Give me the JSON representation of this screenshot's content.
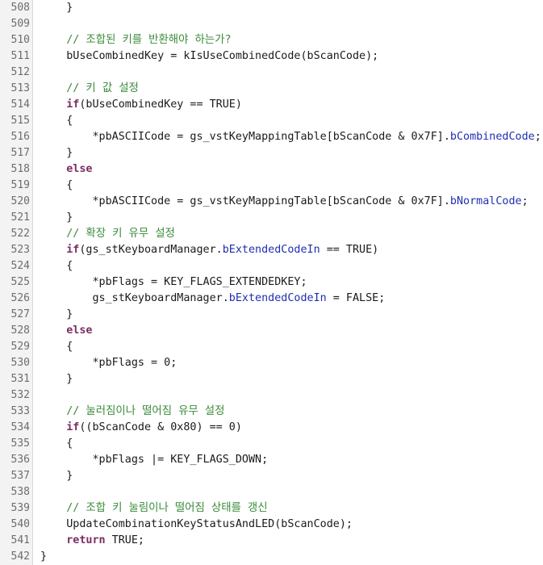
{
  "colors": {
    "gutter_bg": "#f3f3f3",
    "line_number": "#6d6d6d",
    "text": "#1a1a1a",
    "comment": "#3a8a3a",
    "keyword": "#7b2d63",
    "field": "#1f2fb0"
  },
  "lines": [
    {
      "num": "508",
      "tokens": [
        {
          "t": "plain",
          "v": "    }"
        }
      ]
    },
    {
      "num": "509",
      "tokens": []
    },
    {
      "num": "510",
      "tokens": [
        {
          "t": "comment",
          "v": "    // 조합된 키를 반환해야 하는가?"
        }
      ]
    },
    {
      "num": "511",
      "tokens": [
        {
          "t": "plain",
          "v": "    bUseCombinedKey = kIsUseCombinedCode(bScanCode);"
        }
      ]
    },
    {
      "num": "512",
      "tokens": []
    },
    {
      "num": "513",
      "tokens": [
        {
          "t": "comment",
          "v": "    // 키 값 설정"
        }
      ]
    },
    {
      "num": "514",
      "tokens": [
        {
          "t": "plain",
          "v": "    "
        },
        {
          "t": "keyword",
          "v": "if"
        },
        {
          "t": "plain",
          "v": "(bUseCombinedKey == TRUE)"
        }
      ]
    },
    {
      "num": "515",
      "tokens": [
        {
          "t": "plain",
          "v": "    {"
        }
      ]
    },
    {
      "num": "516",
      "tokens": [
        {
          "t": "plain",
          "v": "        *pbASCIICode = gs_vstKeyMappingTable[bScanCode & 0x7F]."
        },
        {
          "t": "field",
          "v": "bCombinedCode"
        },
        {
          "t": "plain",
          "v": ";"
        }
      ]
    },
    {
      "num": "517",
      "tokens": [
        {
          "t": "plain",
          "v": "    }"
        }
      ]
    },
    {
      "num": "518",
      "tokens": [
        {
          "t": "plain",
          "v": "    "
        },
        {
          "t": "keyword",
          "v": "else"
        }
      ]
    },
    {
      "num": "519",
      "tokens": [
        {
          "t": "plain",
          "v": "    {"
        }
      ]
    },
    {
      "num": "520",
      "tokens": [
        {
          "t": "plain",
          "v": "        *pbASCIICode = gs_vstKeyMappingTable[bScanCode & 0x7F]."
        },
        {
          "t": "field",
          "v": "bNormalCode"
        },
        {
          "t": "plain",
          "v": ";"
        }
      ]
    },
    {
      "num": "521",
      "tokens": [
        {
          "t": "plain",
          "v": "    }"
        }
      ]
    },
    {
      "num": "522",
      "tokens": [
        {
          "t": "comment",
          "v": "    // 확장 키 유무 설정"
        }
      ]
    },
    {
      "num": "523",
      "tokens": [
        {
          "t": "plain",
          "v": "    "
        },
        {
          "t": "keyword",
          "v": "if"
        },
        {
          "t": "plain",
          "v": "(gs_stKeyboardManager."
        },
        {
          "t": "field",
          "v": "bExtendedCodeIn"
        },
        {
          "t": "plain",
          "v": " == TRUE)"
        }
      ]
    },
    {
      "num": "524",
      "tokens": [
        {
          "t": "plain",
          "v": "    {"
        }
      ]
    },
    {
      "num": "525",
      "tokens": [
        {
          "t": "plain",
          "v": "        *pbFlags = KEY_FLAGS_EXTENDEDKEY;"
        }
      ]
    },
    {
      "num": "526",
      "tokens": [
        {
          "t": "plain",
          "v": "        gs_stKeyboardManager."
        },
        {
          "t": "field",
          "v": "bExtendedCodeIn"
        },
        {
          "t": "plain",
          "v": " = FALSE;"
        }
      ]
    },
    {
      "num": "527",
      "tokens": [
        {
          "t": "plain",
          "v": "    }"
        }
      ]
    },
    {
      "num": "528",
      "tokens": [
        {
          "t": "plain",
          "v": "    "
        },
        {
          "t": "keyword",
          "v": "else"
        }
      ]
    },
    {
      "num": "529",
      "tokens": [
        {
          "t": "plain",
          "v": "    {"
        }
      ]
    },
    {
      "num": "530",
      "tokens": [
        {
          "t": "plain",
          "v": "        *pbFlags = 0;"
        }
      ]
    },
    {
      "num": "531",
      "tokens": [
        {
          "t": "plain",
          "v": "    }"
        }
      ]
    },
    {
      "num": "532",
      "tokens": []
    },
    {
      "num": "533",
      "tokens": [
        {
          "t": "comment",
          "v": "    // 눌러짐이나 떨어짐 유무 설정"
        }
      ]
    },
    {
      "num": "534",
      "tokens": [
        {
          "t": "plain",
          "v": "    "
        },
        {
          "t": "keyword",
          "v": "if"
        },
        {
          "t": "plain",
          "v": "((bScanCode & 0x80) == 0)"
        }
      ]
    },
    {
      "num": "535",
      "tokens": [
        {
          "t": "plain",
          "v": "    {"
        }
      ]
    },
    {
      "num": "536",
      "tokens": [
        {
          "t": "plain",
          "v": "        *pbFlags |= KEY_FLAGS_DOWN;"
        }
      ]
    },
    {
      "num": "537",
      "tokens": [
        {
          "t": "plain",
          "v": "    }"
        }
      ]
    },
    {
      "num": "538",
      "tokens": []
    },
    {
      "num": "539",
      "tokens": [
        {
          "t": "comment",
          "v": "    // 조합 키 눌림이나 떨어짐 상태를 갱신"
        }
      ]
    },
    {
      "num": "540",
      "tokens": [
        {
          "t": "plain",
          "v": "    UpdateCombinationKeyStatusAndLED(bScanCode);"
        }
      ]
    },
    {
      "num": "541",
      "tokens": [
        {
          "t": "plain",
          "v": "    "
        },
        {
          "t": "keyword",
          "v": "return"
        },
        {
          "t": "plain",
          "v": " TRUE;"
        }
      ]
    },
    {
      "num": "542",
      "tokens": [
        {
          "t": "plain",
          "v": "}"
        }
      ]
    }
  ]
}
